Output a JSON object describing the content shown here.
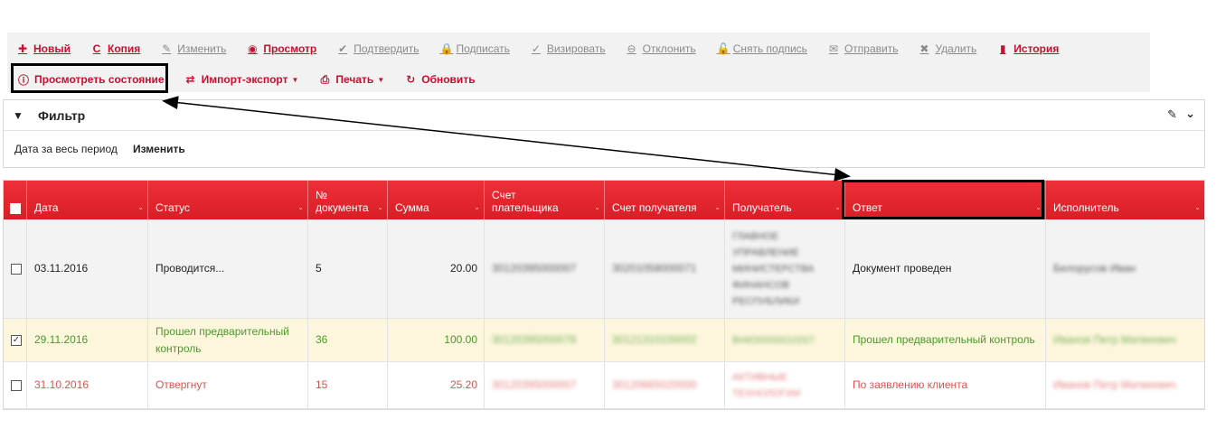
{
  "toolbar": {
    "row1": [
      {
        "name": "new-button",
        "icon": "plus-icon",
        "glyph": "✚",
        "label": "Новый",
        "state": "active"
      },
      {
        "name": "copy-button",
        "icon": "copy-refresh-icon",
        "glyph": "C",
        "label": "Копия",
        "state": "active"
      },
      {
        "name": "edit-button",
        "icon": "pencil-icon",
        "glyph": "✎",
        "label": "Изменить",
        "state": "disabled"
      },
      {
        "name": "view-button",
        "icon": "eye-icon",
        "glyph": "◉",
        "label": "Просмотр",
        "state": "active"
      },
      {
        "name": "confirm-button",
        "icon": "check-icon",
        "glyph": "✔",
        "label": "Подтвердить",
        "state": "disabled"
      },
      {
        "name": "sign-button",
        "icon": "lock-icon",
        "glyph": "🔒",
        "label": "Подписать",
        "state": "disabled"
      },
      {
        "name": "approve-button",
        "icon": "check-circle-icon",
        "glyph": "✓",
        "label": "Визировать",
        "state": "disabled"
      },
      {
        "name": "reject-button",
        "icon": "minus-circle-icon",
        "glyph": "⊖",
        "label": "Отклонить",
        "state": "disabled"
      },
      {
        "name": "remove-signature-button",
        "icon": "unlock-icon",
        "glyph": "🔓",
        "label": "Снять подпись",
        "state": "disabled"
      },
      {
        "name": "send-button",
        "icon": "envelope-icon",
        "glyph": "✉",
        "label": "Отправить",
        "state": "disabled"
      },
      {
        "name": "delete-button",
        "icon": "close-icon",
        "glyph": "✖",
        "label": "Удалить",
        "state": "disabled"
      },
      {
        "name": "history-button",
        "icon": "book-icon",
        "glyph": "▮",
        "label": "История",
        "state": "active"
      }
    ],
    "row2": [
      {
        "name": "view-status-button",
        "icon": "info-circle-icon",
        "glyph": "ⓘ",
        "label": "Просмотреть состояние",
        "state": "active"
      },
      {
        "name": "import-export-button",
        "icon": "shuffle-icon",
        "glyph": "⇄",
        "label": "Импорт-экспорт",
        "state": "active",
        "dropdown": true
      },
      {
        "name": "print-button",
        "icon": "printer-icon",
        "glyph": "⎙",
        "label": "Печать",
        "state": "active",
        "dropdown": true
      },
      {
        "name": "refresh-button",
        "icon": "refresh-icon",
        "glyph": "↻",
        "label": "Обновить",
        "state": "active"
      }
    ]
  },
  "filter": {
    "title": "Фильтр",
    "period": "Дата за весь период",
    "change_label": "Изменить"
  },
  "table": {
    "columns": [
      "Дата",
      "Статус",
      "№ документа",
      "Сумма",
      "Счет плательщика",
      "Счет получателя",
      "Получатель",
      "Ответ",
      "Исполнитель"
    ],
    "rows": [
      {
        "checked": false,
        "date": "03.11.2016",
        "status": "Проводится...",
        "doc_no": "5",
        "amount": "20.00",
        "payer_account": "30120395000007",
        "recipient_account": "30201058000071",
        "recipient": "ГЛАВНОЕ УПРАВЛЕНИЕ МИНИСТЕРСТВА ФИНАНСОВ РЕСПУБЛИКИ",
        "answer": "Документ проведен",
        "executor": "Белорусов Иван"
      },
      {
        "checked": true,
        "date": "29.11.2016",
        "status": "Прошел предварительный контроль",
        "doc_no": "36",
        "amount": "100.00",
        "payer_account": "30120395000078",
        "recipient_account": "30121310100002",
        "recipient": "ВНИЗ0000010207",
        "answer": "Прошел предварительный контроль",
        "executor": "Иванов Петр Матвеевич"
      },
      {
        "checked": false,
        "date": "31.10.2016",
        "status": "Отвергнут",
        "doc_no": "15",
        "amount": "25.20",
        "payer_account": "30120395000007",
        "recipient_account": "30120665020000",
        "recipient": "АКТИВНЫЕ ТЕХНОЛОГИИ",
        "answer": "По заявлению клиента",
        "executor": "Иванов Петр Матвеевич"
      }
    ]
  },
  "colors": {
    "accent": "#c8102e",
    "header_red": "#e4262e",
    "disabled": "#8a8a8a",
    "success_text": "#4a9b2a",
    "success_bg": "#fcf6dd",
    "rejected_text": "#d9534f"
  }
}
